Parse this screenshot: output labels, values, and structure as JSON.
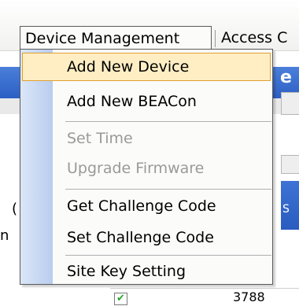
{
  "menubar": {
    "menus": [
      {
        "label": "Device Management"
      },
      {
        "label": "Access C"
      }
    ]
  },
  "background": {
    "header_partial_text": "e",
    "side_tab_text": "S",
    "left_glyphs": [
      "(",
      "n"
    ],
    "row_value": "3788",
    "row_checkbox_checked": true
  },
  "dropdown": {
    "items": [
      {
        "label": "Add New Device",
        "enabled": true,
        "highlighted": true
      },
      {
        "label": "Add New BEACon",
        "enabled": true,
        "highlighted": false
      },
      {
        "label": "Set Time",
        "enabled": false,
        "highlighted": false
      },
      {
        "label": "Upgrade Firmware",
        "enabled": false,
        "highlighted": false
      },
      {
        "label": "Get Challenge Code",
        "enabled": true,
        "highlighted": false
      },
      {
        "label": "Set Challenge Code",
        "enabled": true,
        "highlighted": false
      },
      {
        "label": "Site Key Setting",
        "enabled": true,
        "highlighted": false
      }
    ]
  },
  "colors": {
    "highlight_bg": "#ffeec4",
    "highlight_border": "#e0a030",
    "header_blue": "#2c5fc4",
    "disabled_text": "#9a9a9a"
  }
}
